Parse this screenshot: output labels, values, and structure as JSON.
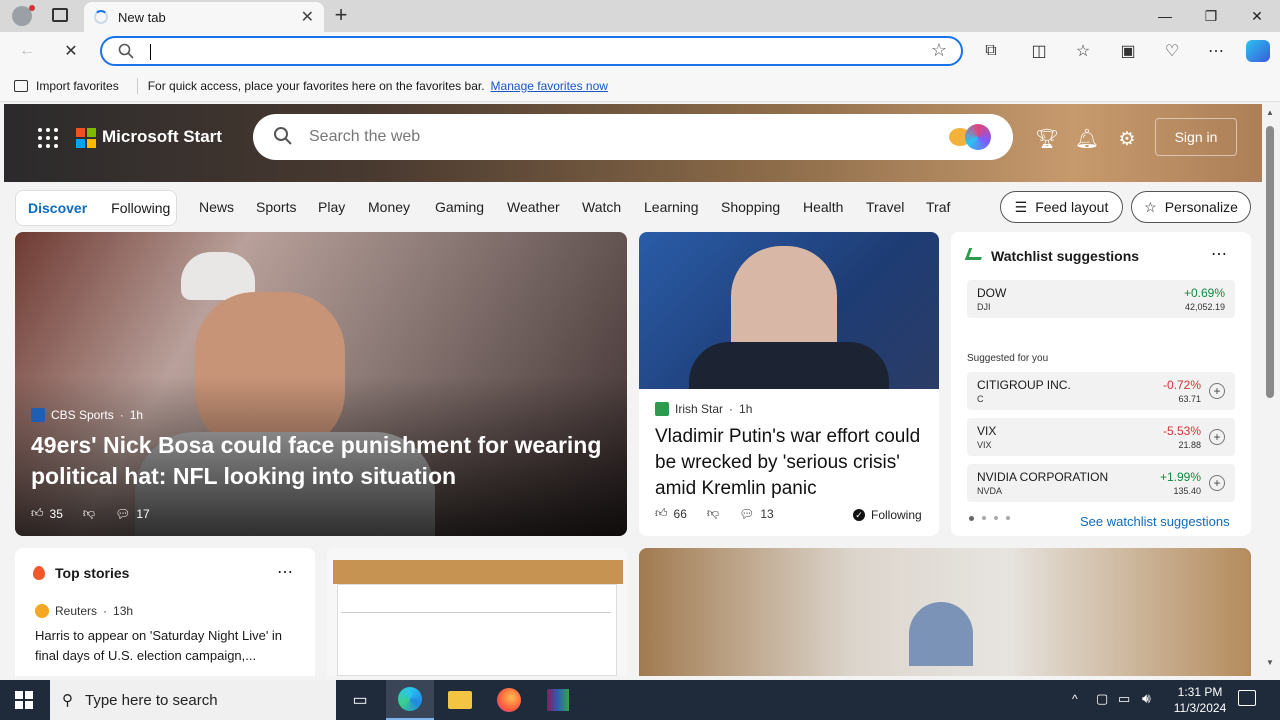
{
  "browser": {
    "tab_title": "New tab",
    "new_tab_symbol": "+",
    "address_value": "",
    "favorites_bar": {
      "import_label": "Import favorites",
      "message": "For quick access, place your favorites here on the favorites bar.",
      "link_label": "Manage favorites now"
    }
  },
  "header": {
    "brand": "Microsoft Start",
    "search_placeholder": "Search the web",
    "sign_in": "Sign in",
    "colors": {
      "accent": "#0f6cbd"
    }
  },
  "nav": {
    "pill": [
      "Discover",
      "Following"
    ],
    "items": [
      "News",
      "Sports",
      "Play",
      "Money",
      "Gaming",
      "Weather",
      "Watch",
      "Learning",
      "Shopping",
      "Health",
      "Travel",
      "Traf"
    ],
    "feed_layout": "Feed layout",
    "personalize": "Personalize"
  },
  "hero_card": {
    "source": "CBS Sports",
    "time": "1h",
    "title": "49ers' Nick Bosa could face punishment for wearing political hat: NFL looking into situation",
    "likes": "35",
    "comments": "17"
  },
  "putin_card": {
    "source": "Irish Star",
    "time": "1h",
    "title": "Vladimir Putin's war effort could be wrecked by 'serious crisis' amid Kremlin panic",
    "likes": "66",
    "comments": "13",
    "following": "Following"
  },
  "watchlist": {
    "title": "Watchlist suggestions",
    "main": {
      "name": "DOW",
      "ticker": "DJI",
      "change": "+0.69%",
      "price": "42,052.19"
    },
    "suggested_label": "Suggested for you",
    "rows": [
      {
        "name": "CITIGROUP INC.",
        "ticker": "C",
        "change": "-0.72%",
        "price": "63.71"
      },
      {
        "name": "VIX",
        "ticker": "VIX",
        "change": "-5.53%",
        "price": "21.88"
      },
      {
        "name": "NVIDIA CORPORATION",
        "ticker": "NVDA",
        "change": "+1.99%",
        "price": "135.40"
      }
    ],
    "see_more": "See watchlist suggestions",
    "colors": {
      "up": "#0f8a3c",
      "down": "#d13438"
    }
  },
  "top_stories": {
    "title": "Top stories",
    "source": "Reuters",
    "time": "13h",
    "headline": "Harris to appear on 'Saturday Night Live' in final days of U.S. election campaign,..."
  },
  "taskbar": {
    "search_placeholder": "Type here to search",
    "time": "1:31 PM",
    "date": "11/3/2024"
  }
}
